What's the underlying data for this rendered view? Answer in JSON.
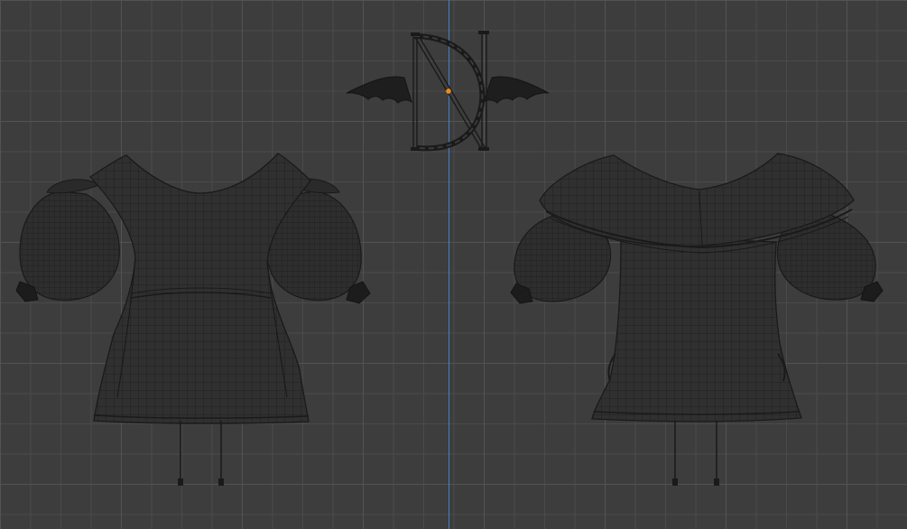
{
  "viewport": {
    "background_color": "#3d3d3d",
    "grid_minor_color": "#4a4a4a",
    "grid_major_color": "#535353",
    "axis_color": "#4a7fc0",
    "mesh_fill": "#2f2f2f",
    "mesh_line": "#1c1c1c",
    "origin_color": "#f08a1c"
  },
  "objects": [
    {
      "name": "logo",
      "icon": "bat-wing-logo"
    },
    {
      "name": "front-view"
    },
    {
      "name": "back-view"
    }
  ]
}
